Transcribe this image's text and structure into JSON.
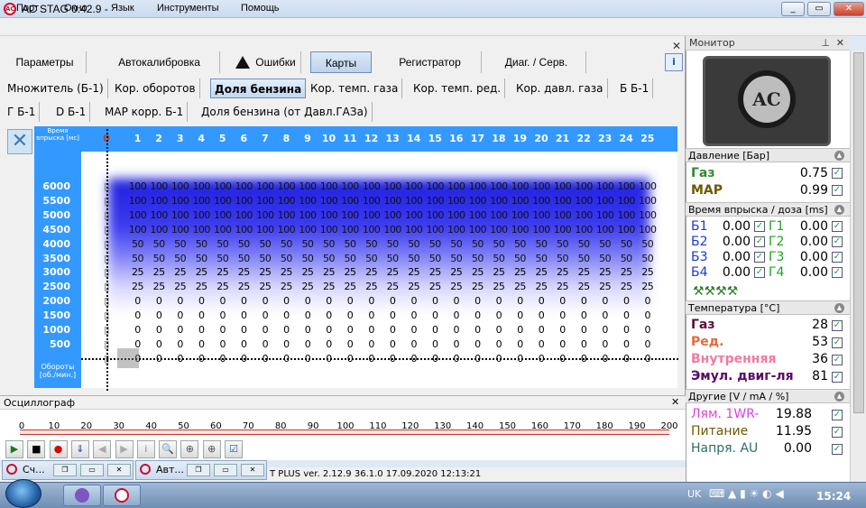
{
  "window": {
    "title": "AC STAG 0.42.9 -",
    "min": "_",
    "max": "▭",
    "close": "✕"
  },
  "menu": [
    "Порт",
    "Окно",
    "Язык",
    "Инструменты",
    "Помощь"
  ],
  "tabs1": [
    "Параметры",
    "Автокалибровка",
    "Ошибки",
    "Карты",
    "Регистратор",
    "Диаг. / Серв."
  ],
  "tabs2_row1": [
    "Множитель (Б-1)",
    "Кор. оборотов",
    "Доля бензина",
    "Кор. темп. газа",
    "Кор. темп. ред.",
    "Кор. давл. газа",
    "Б Б-1"
  ],
  "tabs2_row2": [
    "Г Б-1",
    "D Б-1",
    "MAP корр. Б-1",
    "Доля бензина (от Давл.ГАЗа)"
  ],
  "grid": {
    "corner": "Время впрыска [мс]",
    "rpm_axis": "Обороты [об./мин.]",
    "columns": [
      "0",
      "1",
      "2",
      "3",
      "4",
      "5",
      "6",
      "7",
      "8",
      "9",
      "10",
      "11",
      "12",
      "13",
      "14",
      "15",
      "16",
      "17",
      "18",
      "19",
      "20",
      "21",
      "22",
      "23",
      "24",
      "25"
    ],
    "rows": [
      {
        "rpm": "6000",
        "v": "100"
      },
      {
        "rpm": "5500",
        "v": "100"
      },
      {
        "rpm": "5000",
        "v": "100"
      },
      {
        "rpm": "4500",
        "v": "100"
      },
      {
        "rpm": "4000",
        "v": "50"
      },
      {
        "rpm": "3500",
        "v": "50"
      },
      {
        "rpm": "3000",
        "v": "25"
      },
      {
        "rpm": "2500",
        "v": "25"
      },
      {
        "rpm": "2000",
        "v": "0"
      },
      {
        "rpm": "1500",
        "v": "0"
      },
      {
        "rpm": "1000",
        "v": "0"
      },
      {
        "rpm": "500",
        "v": "0"
      },
      {
        "rpm": "",
        "v": "0"
      }
    ]
  },
  "osc": {
    "title": "Осциллограф",
    "scale": [
      "0",
      "10",
      "20",
      "30",
      "40",
      "50",
      "60",
      "70",
      "80",
      "90",
      "100",
      "110",
      "120",
      "130",
      "140",
      "150",
      "160",
      "170",
      "180",
      "190",
      "200"
    ],
    "buttons": [
      "▶",
      "■",
      "●",
      "⇓",
      "◀",
      "▶",
      "i",
      "🔍",
      "⊕",
      "⊕",
      "☑"
    ]
  },
  "mini_windows": [
    "Сч...",
    "Авт..."
  ],
  "status": "T PLUS  ver. 2.12.9  36.1.0   17.09.2020 12:13:21",
  "monitor": {
    "title": "Монитор",
    "logo": "AC",
    "pressure": {
      "title": "Давление [Бар]",
      "gas_label": "Газ",
      "gas": "0.75",
      "map_label": "MAP",
      "map": "0.99"
    },
    "injection": {
      "title": "Время впрыска / доза [ms]",
      "rows": [
        {
          "b": "Б1",
          "bv": "0.00",
          "g": "Г1",
          "gv": "0.00"
        },
        {
          "b": "Б2",
          "bv": "0.00",
          "g": "Г2",
          "gv": "0.00"
        },
        {
          "b": "Б3",
          "bv": "0.00",
          "g": "Г3",
          "gv": "0.00"
        },
        {
          "b": "Б4",
          "bv": "0.00",
          "g": "Г4",
          "gv": "0.00"
        }
      ]
    },
    "temperature": {
      "title": "Температура [°C]",
      "rows": [
        {
          "l": "Газ",
          "v": "28",
          "c": "#5a0a3a"
        },
        {
          "l": "Ред.",
          "v": "53",
          "c": "#e8693a"
        },
        {
          "l": "Внутренняя",
          "v": "36",
          "c": "#f07aa0"
        },
        {
          "l": "Эмул. двиг-ля",
          "v": "81",
          "c": "#5a0a6a"
        }
      ]
    },
    "other": {
      "title": "Другие [V / mA / %]",
      "rows": [
        {
          "l": "Лям. 1WR-",
          "v": "19.88",
          "c": "#e040e0"
        },
        {
          "l": "Питание",
          "v": "11.95",
          "c": "#6b5a00"
        },
        {
          "l": "Напря. AU",
          "v": "0.00",
          "c": "#2f6b6b"
        }
      ]
    }
  },
  "taskbar": {
    "lang": "UK",
    "time": "15:24"
  }
}
